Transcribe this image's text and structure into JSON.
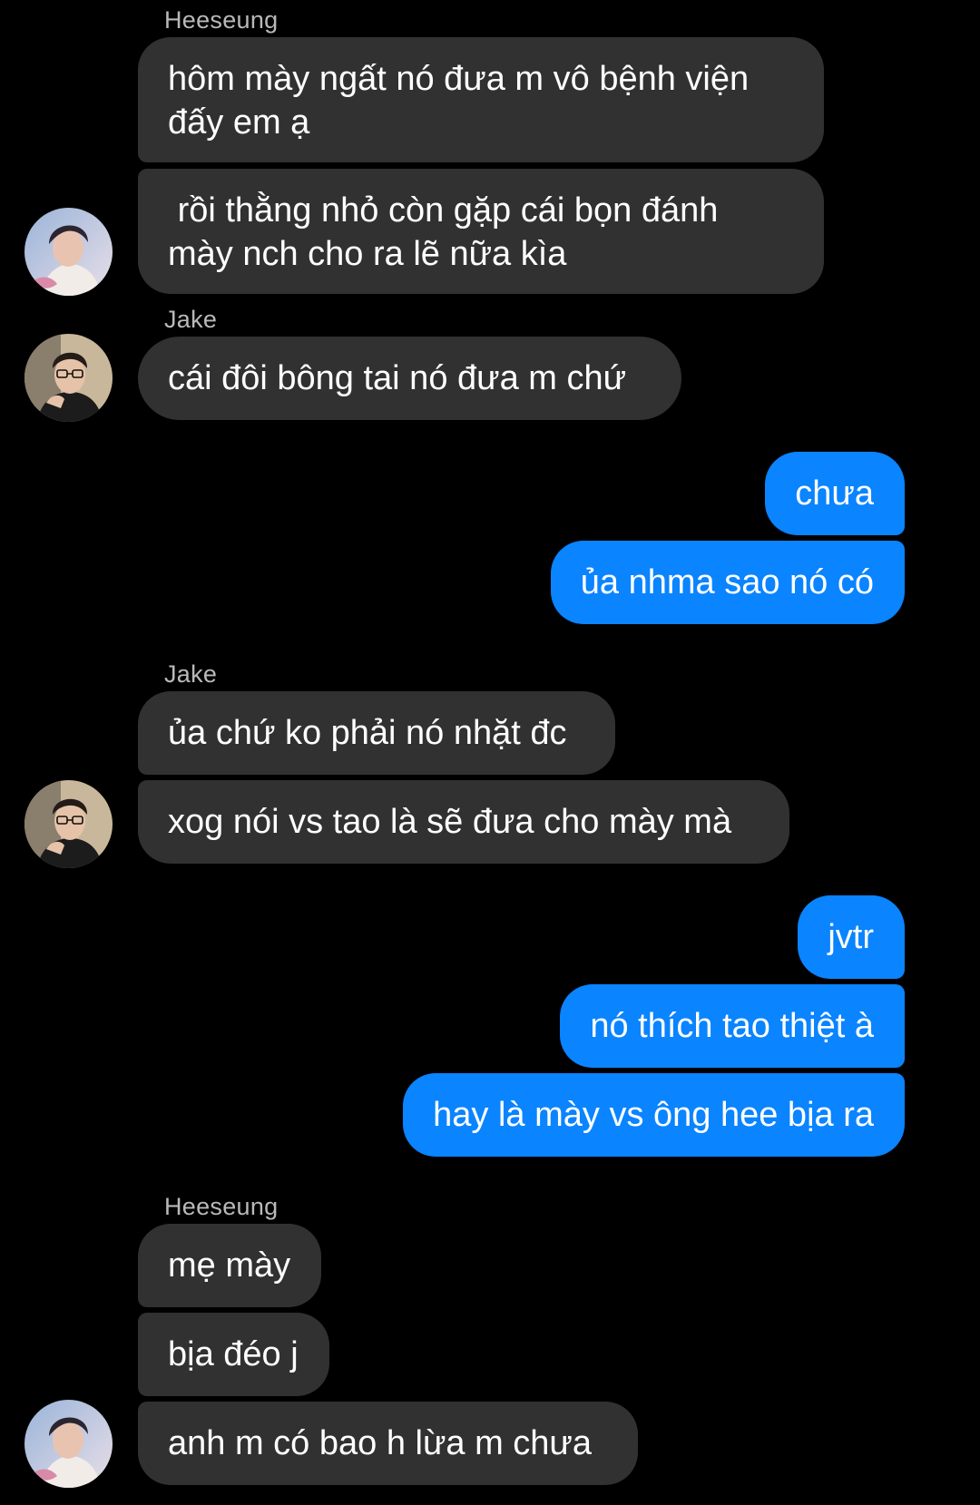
{
  "conversation": {
    "senders": {
      "s1": "Heeseung",
      "s2": "Jake",
      "s3": "Jake",
      "s4": "Heeseung"
    },
    "messages": {
      "m1": "hôm mày ngất nó đưa m vô bệnh viện\nđấy em ạ",
      "m2": " rồi thằng nhỏ còn gặp cái bọn đánh\nmày nch cho ra lẽ nữa kìa",
      "m3": "cái đôi bông tai nó đưa m chứ",
      "m4": "chưa",
      "m5": "ủa nhma sao nó có",
      "m6": "ủa chứ ko phải nó nhặt đc",
      "m7": "xog nói vs tao là sẽ đưa cho mày mà",
      "m8": "jvtr",
      "m9": "nó thích tao thiệt à",
      "m10": "hay là mày vs ông hee bịa ra",
      "m11": "mẹ mày",
      "m12": "bịa đéo j",
      "m13": "anh m có bao h lừa m chưa"
    },
    "avatars": {
      "a1": "heeseung-avatar",
      "a2": "jake-avatar",
      "a3": "jake-avatar",
      "a4": "heeseung-avatar"
    }
  },
  "theme": {
    "background": "#000000",
    "incoming_bubble": "#313131",
    "outgoing_bubble": "#0a84ff",
    "sender_name": "#b9b9b9",
    "text": "#ffffff"
  }
}
